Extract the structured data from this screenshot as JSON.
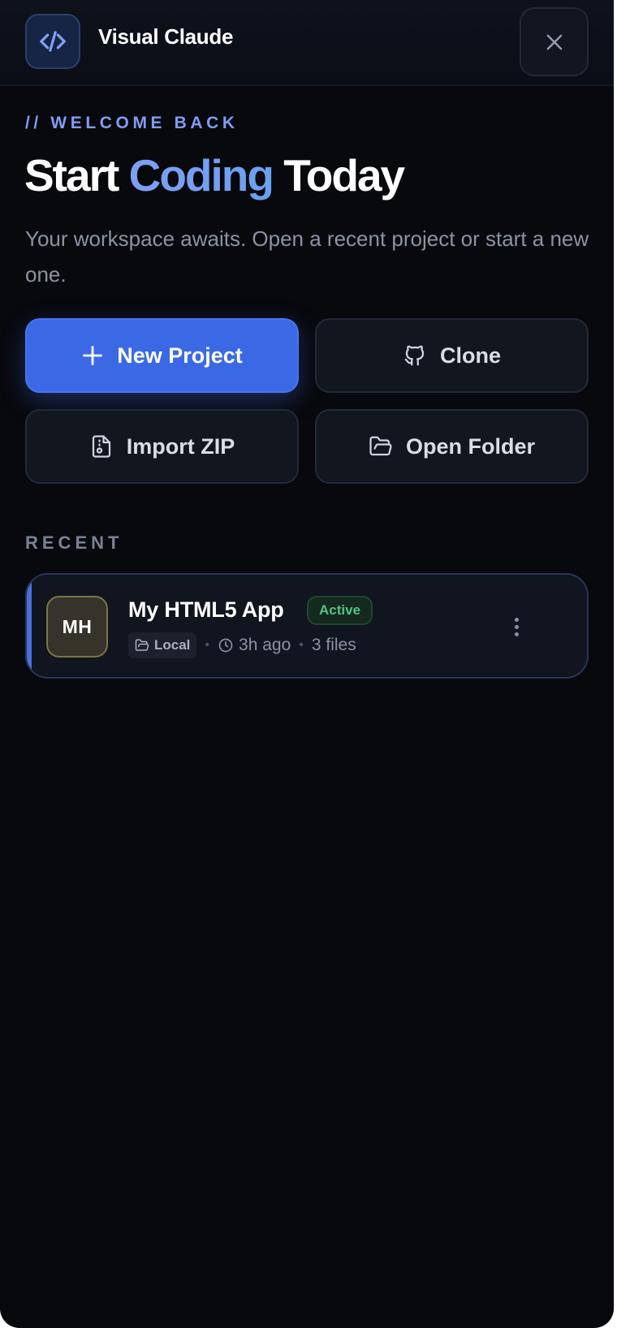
{
  "app": {
    "title": "Visual Claude",
    "logo_icon": "code-icon"
  },
  "header": {
    "close_icon": "close-icon"
  },
  "welcome": {
    "eyebrow": "// WELCOME BACK",
    "headline_start": "Start ",
    "headline_accent": "Coding",
    "headline_end": " Today",
    "subtitle": "Your workspace awaits. Open a recent project or start a new one."
  },
  "actions": [
    {
      "label": "New Project",
      "icon": "plus-icon"
    },
    {
      "label": "Clone",
      "icon": "github-icon"
    },
    {
      "label": "Import ZIP",
      "icon": "zip-file-icon"
    },
    {
      "label": "Open Folder",
      "icon": "folder-open-icon"
    }
  ],
  "recent": {
    "section_label": "RECENT",
    "projects": [
      {
        "initials": "MH",
        "name": "My HTML5 App",
        "status": "Active",
        "location": "Local",
        "updated": "3h ago",
        "files": "3 files"
      }
    ]
  },
  "colors": {
    "background": "#08090d",
    "accent": "#3b69e6",
    "headline_accent": "#7e9ff6",
    "active_status": "#52c47e"
  }
}
